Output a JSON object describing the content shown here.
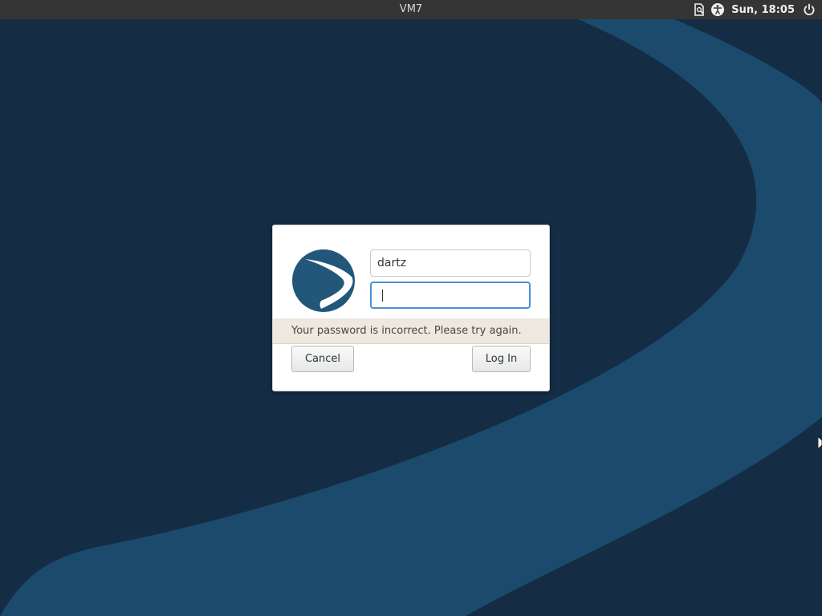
{
  "topbar": {
    "host_label": "VM7",
    "clock": "Sun, 18:05",
    "icons": [
      "document-status-icon",
      "accessibility-icon",
      "power-icon"
    ]
  },
  "login_dialog": {
    "logo_icon": "distro-logo-icon",
    "username_value": "dartz",
    "password_value": "",
    "error_message": "Your password is incorrect. Please try again.",
    "cancel_label": "Cancel",
    "login_label": "Log In"
  },
  "colors": {
    "background": "#142d44",
    "wave": "#1c4a6c",
    "topbar": "#353535",
    "focus": "#4a90d9",
    "logo": "#22577a"
  }
}
